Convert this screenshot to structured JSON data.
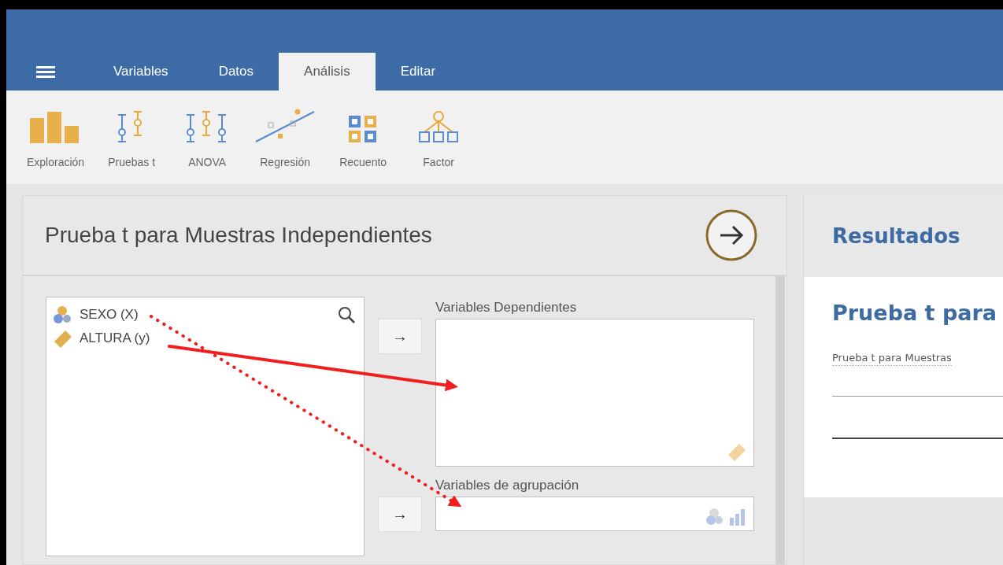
{
  "tabs": [
    {
      "label": "Variables",
      "selected": false
    },
    {
      "label": "Datos",
      "selected": false
    },
    {
      "label": "Análisis",
      "selected": true
    },
    {
      "label": "Editar",
      "selected": false
    }
  ],
  "toolbar": [
    {
      "label": "Exploración",
      "kind": "bars"
    },
    {
      "label": "Pruebas t",
      "kind": "ttest"
    },
    {
      "label": "ANOVA",
      "kind": "anova"
    },
    {
      "label": "Regresión",
      "kind": "regression"
    },
    {
      "label": "Recuento",
      "kind": "grid"
    },
    {
      "label": "Factor",
      "kind": "tree"
    }
  ],
  "analysis": {
    "title": "Prueba t para Muestras Independientes",
    "variables": [
      {
        "name": "SEXO (X)",
        "kind": "nominal"
      },
      {
        "name": "ALTURA (y)",
        "kind": "continuous"
      }
    ],
    "move_buttons": [
      "→",
      "→"
    ],
    "targets": [
      {
        "label": "Variables Dependientes",
        "kind": "continuous"
      },
      {
        "label": "Variables de agrupación",
        "kind": "grouping"
      }
    ]
  },
  "results": {
    "heading": "Resultados",
    "title": "Prueba t para",
    "table_title": "Prueba t para Muestras"
  },
  "annotations": [
    {
      "kind": "solid"
    },
    {
      "kind": "dotted"
    }
  ]
}
